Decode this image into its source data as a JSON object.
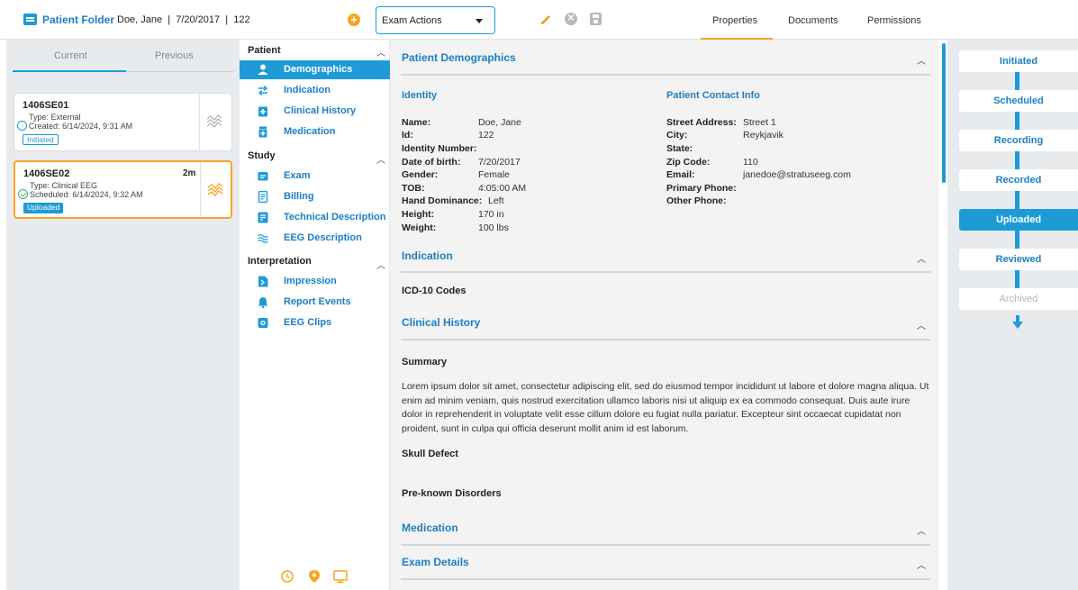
{
  "header": {
    "folder_title": "Patient Folder",
    "patient_meta": "Doe, Jane  |  7/20/2017  |  122",
    "exam_actions_label": "Exam Actions",
    "tabs": [
      {
        "label": "Properties",
        "active": true
      },
      {
        "label": "Documents",
        "active": false
      },
      {
        "label": "Permissions",
        "active": false
      }
    ]
  },
  "exam_list": {
    "tabs": [
      {
        "label": "Current",
        "active": true
      },
      {
        "label": "Previous",
        "active": false
      }
    ],
    "cards": [
      {
        "id": "1406SE01",
        "type": "Type: External",
        "date": "Created: 6/14/2024, 9:31 AM",
        "status": "Initiated",
        "age": "",
        "selected": false
      },
      {
        "id": "1406SE02",
        "type": "Type: Clinical EEG",
        "date": "Scheduled: 6/14/2024, 9:32 AM",
        "status": "Uploaded",
        "age": "2m",
        "selected": true
      }
    ]
  },
  "nav": {
    "sections": [
      {
        "label": "Patient",
        "items": [
          "Demographics",
          "Indication",
          "Clinical History",
          "Medication"
        ]
      },
      {
        "label": "Study",
        "items": [
          "Exam",
          "Billing",
          "Technical Description",
          "EEG Description"
        ]
      },
      {
        "label": "Interpretation",
        "items": [
          "Impression",
          "Report Events",
          "EEG Clips"
        ]
      }
    ],
    "active_item": "Demographics"
  },
  "demographics": {
    "title": "Patient Demographics",
    "identity_title": "Identity",
    "identity": [
      {
        "label": "Name:",
        "value": "Doe, Jane"
      },
      {
        "label": "Id:",
        "value": "122"
      },
      {
        "label": "Identity Number:",
        "value": ""
      },
      {
        "label": "Date of birth:",
        "value": "7/20/2017"
      },
      {
        "label": "Gender:",
        "value": "Female"
      },
      {
        "label": "TOB:",
        "value": "4:05:00 AM"
      },
      {
        "label": "Hand Dominance:",
        "value": "Left"
      },
      {
        "label": "Height:",
        "value": "170 in"
      },
      {
        "label": "Weight:",
        "value": "100 lbs"
      }
    ],
    "contact_title": "Patient Contact Info",
    "contact": [
      {
        "label": "Street Address:",
        "value": "Street 1"
      },
      {
        "label": "City:",
        "value": "Reykjavik"
      },
      {
        "label": "State:",
        "value": ""
      },
      {
        "label": "Zip Code:",
        "value": "110"
      },
      {
        "label": "Email:",
        "value": "janedoe@stratuseeg.com"
      },
      {
        "label": "Primary Phone:",
        "value": ""
      },
      {
        "label": "Other Phone:",
        "value": ""
      }
    ]
  },
  "indication": {
    "title": "Indication",
    "icd_label": "ICD-10 Codes"
  },
  "clinical_history": {
    "title": "Clinical History",
    "summary_label": "Summary",
    "summary_text": "Lorem ipsum dolor sit amet, consectetur adipiscing elit, sed do eiusmod tempor incididunt ut labore et dolore magna aliqua. Ut enim ad minim veniam, quis nostrud exercitation ullamco laboris nisi ut aliquip ex ea commodo consequat. Duis aute irure dolor in reprehenderit in voluptate velit esse cillum dolore eu fugiat nulla pariatur. Excepteur sint occaecat cupidatat non proident, sunt in culpa qui officia deserunt mollit anim id est laborum.",
    "skull_label": "Skull Defect",
    "disorders_label": "Pre-known Disorders"
  },
  "medication": {
    "title": "Medication"
  },
  "exam_details": {
    "title": "Exam Details"
  },
  "workflow": {
    "steps": [
      {
        "label": "Initiated",
        "state": "done"
      },
      {
        "label": "Scheduled",
        "state": "done"
      },
      {
        "label": "Recording",
        "state": "done"
      },
      {
        "label": "Recorded",
        "state": "done"
      },
      {
        "label": "Uploaded",
        "state": "current"
      },
      {
        "label": "Reviewed",
        "state": "next"
      },
      {
        "label": "Archived",
        "state": "future"
      }
    ]
  },
  "colors": {
    "accent": "#1e9bd7",
    "title_blue": "#1c7fc4",
    "highlight": "#f5a623",
    "success": "#3cb371",
    "panel_bg": "#e8ebee"
  }
}
